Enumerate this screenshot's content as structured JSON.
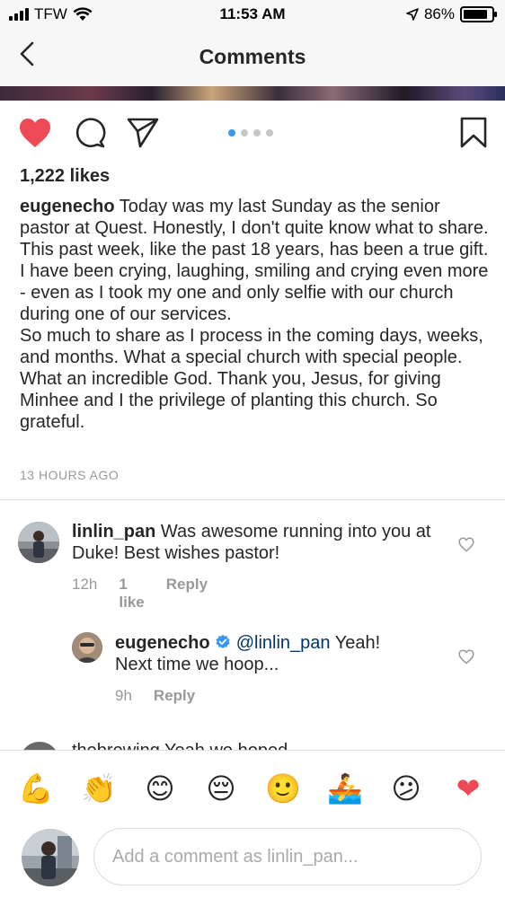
{
  "status_bar": {
    "carrier": "TFW",
    "time": "11:53 AM",
    "battery": "86%",
    "battery_level": 0.86
  },
  "nav": {
    "title": "Comments",
    "back_icon": "chevron-left-icon"
  },
  "post": {
    "carousel_pages": 4,
    "carousel_active": 1,
    "likes": "1,222 likes",
    "caption_user": "eugenecho",
    "caption_line1": "Today was my last Sunday as the senior pastor at Quest. Honestly, I don't quite know what to share. This past week, like the past 18 years, has been a true gift. I have been crying, laughing, smiling and crying even more - even as I took my one and only selfie with our church during one of our services.",
    "caption_line2": "So much to share as I process in the coming days, weeks, and months. What a special church with special people. What an incredible God. Thank you, Jesus, for giving Minhee and I the privilege of planting this church. So grateful.",
    "age": "13 HOURS AGO",
    "colors": {
      "like_red": "#ed4956",
      "link_blue": "#3897f0"
    }
  },
  "comments": [
    {
      "user": "linlin_pan",
      "text": "Was awesome running into you at Duke! Best wishes pastor!",
      "time": "12h",
      "likes": "1 like",
      "reply": "Reply"
    }
  ],
  "replies": [
    {
      "user": "eugenecho",
      "mention": "@linlin_pan",
      "text": "Yeah! Next time we hoop...",
      "time": "9h",
      "reply": "Reply"
    }
  ],
  "partial_comment": {
    "text": "thebrewing Yeah we hoped..."
  },
  "emoji_bar": [
    "💪",
    "👏",
    "😊",
    "😔",
    "🙂",
    "🚣",
    "😕",
    "❤"
  ],
  "composer": {
    "placeholder": "Add a comment as linlin_pan..."
  }
}
